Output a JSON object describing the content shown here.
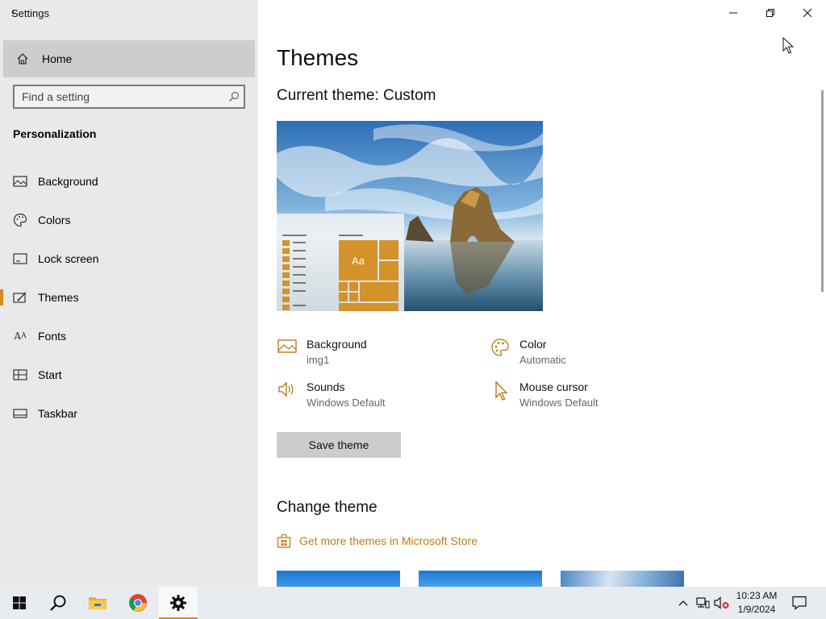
{
  "window": {
    "title": "Settings",
    "controls": {
      "minimize": "minimize",
      "maximize": "restore",
      "close": "close"
    }
  },
  "sidebar": {
    "home_label": "Home",
    "search_placeholder": "Find a setting",
    "section_heading": "Personalization",
    "items": [
      {
        "label": "Background",
        "icon": "image-icon"
      },
      {
        "label": "Colors",
        "icon": "palette-icon"
      },
      {
        "label": "Lock screen",
        "icon": "lock-screen-icon"
      },
      {
        "label": "Themes",
        "icon": "themes-icon",
        "selected": true
      },
      {
        "label": "Fonts",
        "icon": "fonts-icon"
      },
      {
        "label": "Start",
        "icon": "start-icon"
      },
      {
        "label": "Taskbar",
        "icon": "taskbar-icon"
      }
    ]
  },
  "main": {
    "title": "Themes",
    "current_theme": "Current theme: Custom",
    "preview_tile_text": "Aa",
    "attributes": {
      "background": {
        "name": "Background",
        "value": "img1"
      },
      "color": {
        "name": "Color",
        "value": "Automatic"
      },
      "sounds": {
        "name": "Sounds",
        "value": "Windows Default"
      },
      "mouse_cursor": {
        "name": "Mouse cursor",
        "value": "Windows Default"
      }
    },
    "save_button": "Save theme",
    "change_theme_heading": "Change theme",
    "store_link": "Get more themes in Microsoft Store"
  },
  "taskbar": {
    "clock_time": "10:23 AM",
    "clock_date": "1/9/2024",
    "pinned": [
      "start",
      "search",
      "file-explorer",
      "chrome",
      "settings"
    ],
    "active": "settings"
  },
  "colors": {
    "accent": "#d88a1a",
    "sidebar_bg": "#e9e9e9",
    "link": "#c27d0e"
  }
}
